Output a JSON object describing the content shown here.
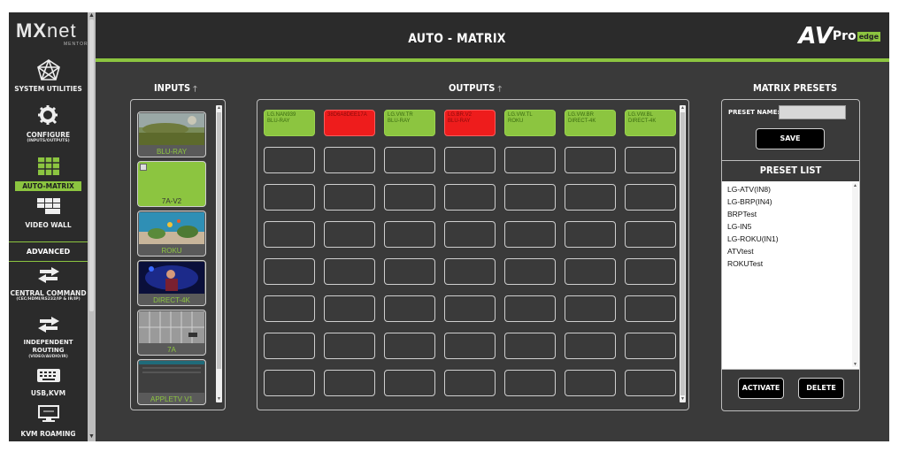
{
  "sidebar": {
    "logo_main": "MX",
    "logo_net": "net",
    "logo_sub": "MENTOR",
    "items": [
      {
        "label": "SYSTEM UTILITIES",
        "sub": "",
        "icon": "network-icon"
      },
      {
        "label": "CONFIGURE",
        "sub": "(INPUTS/OUTPUTS)",
        "icon": "gear-icon"
      },
      {
        "label": "AUTO-MATRIX",
        "sub": "",
        "icon": "grid-icon",
        "active": true
      },
      {
        "label": "VIDEO WALL",
        "sub": "",
        "icon": "video-wall-icon"
      },
      {
        "label": "CENTRAL COMMAND",
        "sub": "(CEC/HDMI/RS232/IP & IR/IP)",
        "icon": "arrows-icon"
      },
      {
        "label": "INDEPENDENT ROUTING",
        "sub": "(VIDEO/AUDIO/IR)",
        "icon": "arrows-icon"
      },
      {
        "label": "USB,KVM",
        "sub": "",
        "icon": "keyboard-icon"
      },
      {
        "label": "KVM ROAMING",
        "sub": "",
        "icon": "monitor-icon"
      }
    ],
    "advanced_label": "ADVANCED"
  },
  "header": {
    "title": "AUTO - MATRIX",
    "brand_av": "AV",
    "brand_pro": "Pro",
    "brand_edge": "edge"
  },
  "inputs": {
    "heading": "INPUTS",
    "sort_icon": "up-arrow-icon",
    "tiles": [
      {
        "label": "BLU-RAY",
        "thumb": "landscape"
      },
      {
        "label": "7A-V2",
        "thumb": "green"
      },
      {
        "label": "ROKU",
        "thumb": "aquarium"
      },
      {
        "label": "DIRECT-4K",
        "thumb": "concert"
      },
      {
        "label": "7A",
        "thumb": "grid"
      },
      {
        "label": "APPLETV V1",
        "thumb": "screen"
      }
    ]
  },
  "outputs": {
    "heading": "OUTPUTS",
    "sort_icon": "up-arrow-icon",
    "filled": [
      {
        "name": "LG.NAN939",
        "source": "BLU-RAY",
        "status": "green"
      },
      {
        "name": "38D6A8DEE17A",
        "source": "",
        "status": "red"
      },
      {
        "name": "LG.VW.TR",
        "source": "BLU-RAY",
        "status": "green"
      },
      {
        "name": "LG.BR.V2",
        "source": "BLU-RAY",
        "status": "red"
      },
      {
        "name": "LG.VW.TL",
        "source": "ROKU",
        "status": "green"
      },
      {
        "name": "LG.VW.BR",
        "source": "DIRECT-4K",
        "status": "green"
      },
      {
        "name": "LG.VW.BL",
        "source": "DIRECT-4K",
        "status": "green"
      }
    ],
    "empty_rows": 7,
    "columns": 7
  },
  "presets": {
    "heading": "MATRIX PRESETS",
    "name_label": "PRESET NAME:",
    "name_value": "",
    "save_label": "SAVE",
    "list_heading": "PRESET LIST",
    "list": [
      "LG-ATV(IN8)",
      "LG-BRP(IN4)",
      "BRPTest",
      "LG-IN5",
      "LG-ROKU(IN1)",
      "ATVtest",
      "ROKUTest"
    ],
    "activate_label": "ACTIVATE",
    "delete_label": "DELETE"
  },
  "colors": {
    "accent": "#8cc540",
    "alert": "#ee1c1c",
    "background": "#3a3a3a",
    "sidebar": "#2b2b2b"
  }
}
